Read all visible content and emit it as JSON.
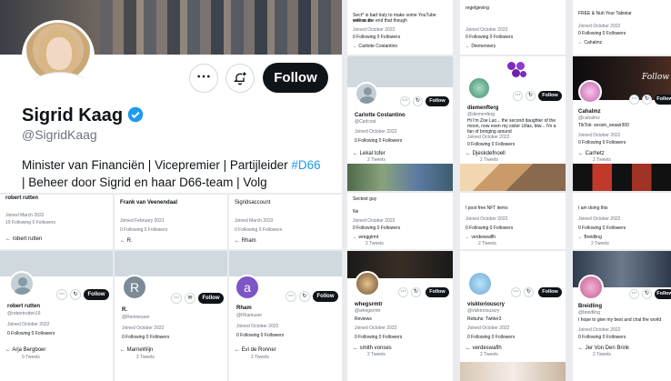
{
  "colors": {
    "accent": "#1d9bf0",
    "follow_bg": "#0f1419",
    "verified": "#1d9bf0"
  },
  "main_profile": {
    "name": "Sigrid Kaag",
    "handle": "@SigridKaag",
    "bio_line1_a": "Minister van Financiën | Vicepremier | Partijleider ",
    "bio_hashtag": "#D66",
    "bio_line2": "| Beheer door Sigrid en haar D66-team | Volg",
    "follow_label": "Follow",
    "more_icon": "more-icon",
    "notify_icon": "bell-plus-icon",
    "verified_icon": "verified-badge-icon"
  },
  "strip": {
    "names": [
      "robert rutten",
      "Frank van Veenendaal",
      "Sigridsaccount"
    ],
    "nav": [
      "robert rutten",
      "R.",
      "Rham"
    ],
    "tweets": [
      "2 Tweets",
      "2 Tweets",
      "2 Tweets"
    ],
    "following": [
      "19 Following 0 Followers",
      "0 Following 0 Followers",
      "0 Following 0 Followers"
    ],
    "joined": [
      "Joined March 2022",
      "Joined February 2021",
      "Joined March 2022"
    ]
  },
  "bottom_left": [
    {
      "name": "robert rutten",
      "handle": "@robertrutten16",
      "joined": "Joined October 2022",
      "stats": "0 Following  0 Followers",
      "nav": "Arja Bergboer",
      "tweets": "0 Tweets",
      "avatar_letter": "",
      "follow": "Follow"
    },
    {
      "name": "R.",
      "handle": "@Rsomeuser",
      "joined": "Joined October 2022",
      "stats": "0 Following  0 Followers",
      "nav": "MarrieWijn",
      "tweets": "2 Tweets",
      "avatar_letter": "R",
      "follow": "Follow"
    },
    {
      "name": "Rham",
      "handle": "@Rhamuser",
      "joined": "Joined October 2022",
      "stats": "0 Following  0 Followers",
      "nav": "Evi de Ronner",
      "tweets": "2 Tweets",
      "avatar_letter": "a",
      "follow": "Follow"
    }
  ],
  "right_top": [
    {
      "line1": "Sect^ is bad truly to make some YouTube videos as",
      "line2": "well as the end that though",
      "joined": "Joined October 2022",
      "stats": "0 Following  0 Followers",
      "nav": "Carlotte Costantino"
    },
    {
      "line1": "regelgeving",
      "line2": "",
      "joined": "Joined October 2022",
      "stats": "0 Following  0 Followers",
      "nav": "Diemennery"
    },
    {
      "line1": "FREE & Nuh Your Tabiolar",
      "line2": "",
      "joined": "Joined October 2022",
      "stats": "0 Following  0 Followers",
      "nav": "Cahalmz"
    }
  ],
  "right_mid": [
    {
      "name": "Carlotte Costantino",
      "handle": "@Carlcost",
      "joined": "Joined October 2022",
      "stats": "0 Following  0 Followers",
      "nav": "Lekal tofer",
      "tweets": "2 Tweets",
      "follow": "Follow"
    },
    {
      "name": "diemenfterg",
      "handle": "@diemenferg",
      "bio": "Hi I'm Zoe Lac... the second daughter of the moon, now even my sister Lillas, btw... I'm a fan of bringing around",
      "joined": "Joined October 2022",
      "stats": "0 Following  0 Followers",
      "nav": "Djeskdefnoell",
      "tweets": "2 Tweets",
      "follow": "Follow"
    },
    {
      "name": "Cahalmz",
      "handle": "@cahalmz",
      "bio": "TikTok: sexsin_seaair300",
      "joined": "Joined October 2022",
      "stats": "0 Following  0 Followers",
      "nav": "Carhetz",
      "tweets": "2 Tweets",
      "follow": "Follow"
    }
  ],
  "right_lower": [
    {
      "line1": "Sectest guy",
      "line2": "Ne",
      "joined": "Joined October 2022",
      "stats": "0 Following  0 Followers",
      "nav": "wreggirmt",
      "tweets": "2 Tweets"
    },
    {
      "line1": "I post free NFT items",
      "line2": "",
      "joined": "Joined October 2022",
      "stats": "0 Following  0 Followers",
      "nav": "verdeswaflh",
      "tweets": "2 Tweets"
    },
    {
      "line1": "I am doing this",
      "line2": "",
      "joined": "Joined October 2022",
      "stats": "0 Following  0 Followers",
      "nav": "Breidling",
      "tweets": "2 Tweets"
    }
  ],
  "right_bottom": [
    {
      "name": "whegsrmtr",
      "handle": "@whegsrmtr",
      "bio": "Reviews",
      "joined": "Joined October 2022",
      "stats": "0 Following  0 Followers",
      "nav": "smith vonses",
      "tweets": "2 Tweets",
      "follow": "Follow"
    },
    {
      "name": "visktoriouscry",
      "handle": "@visktoriouscry",
      "bio": "Rebuhs: Twitter3",
      "joined": "Joined October 2022",
      "stats": "0 Following  0 Followers",
      "nav": "verdeswaflh",
      "tweets": "2 Tweets",
      "follow": "Follow"
    },
    {
      "name": "Breidling",
      "handle": "@breidling",
      "bio": "I hope to give my best and chat the world",
      "joined": "Joined October 2022",
      "stats": "0 Following  0 Followers",
      "nav": "Jer Von Den Brink",
      "tweets": "2 Tweets",
      "follow": "Follow"
    }
  ]
}
